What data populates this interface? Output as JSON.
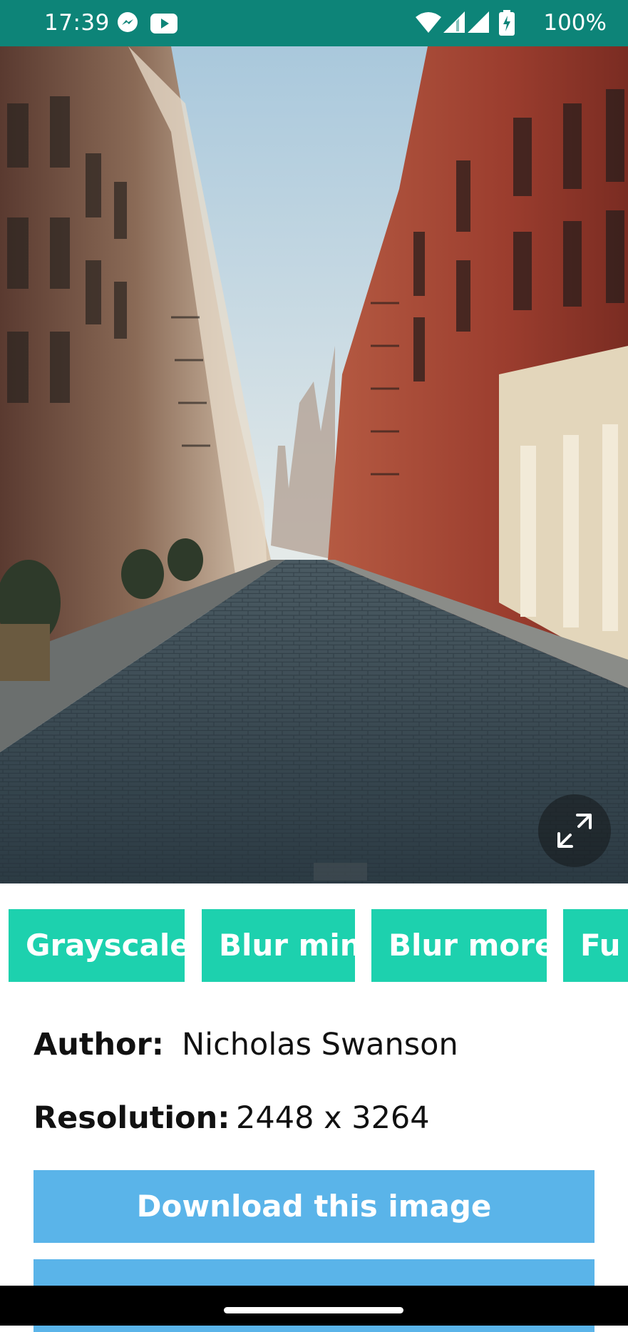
{
  "status_bar": {
    "time": "17:39",
    "battery": "100%",
    "icons": [
      "messenger-icon",
      "youtube-icon",
      "wifi-icon",
      "signal-icon",
      "signal-icon",
      "battery-charging-icon"
    ]
  },
  "photo": {
    "description_icon": "fullscreen-expand-icon"
  },
  "filters": [
    "Grayscale",
    "Blur min",
    "Blur more",
    "Fu"
  ],
  "info": {
    "author_label": "Author:",
    "author_value": "Nicholas Swanson",
    "resolution_label": "Resolution:",
    "resolution_value": "2448 x 3264"
  },
  "actions": {
    "download_label": "Download this image",
    "second_label": ""
  },
  "colors": {
    "status_bar": "#0d8478",
    "chip": "#1dd1ae",
    "button": "#5ab4e9"
  }
}
